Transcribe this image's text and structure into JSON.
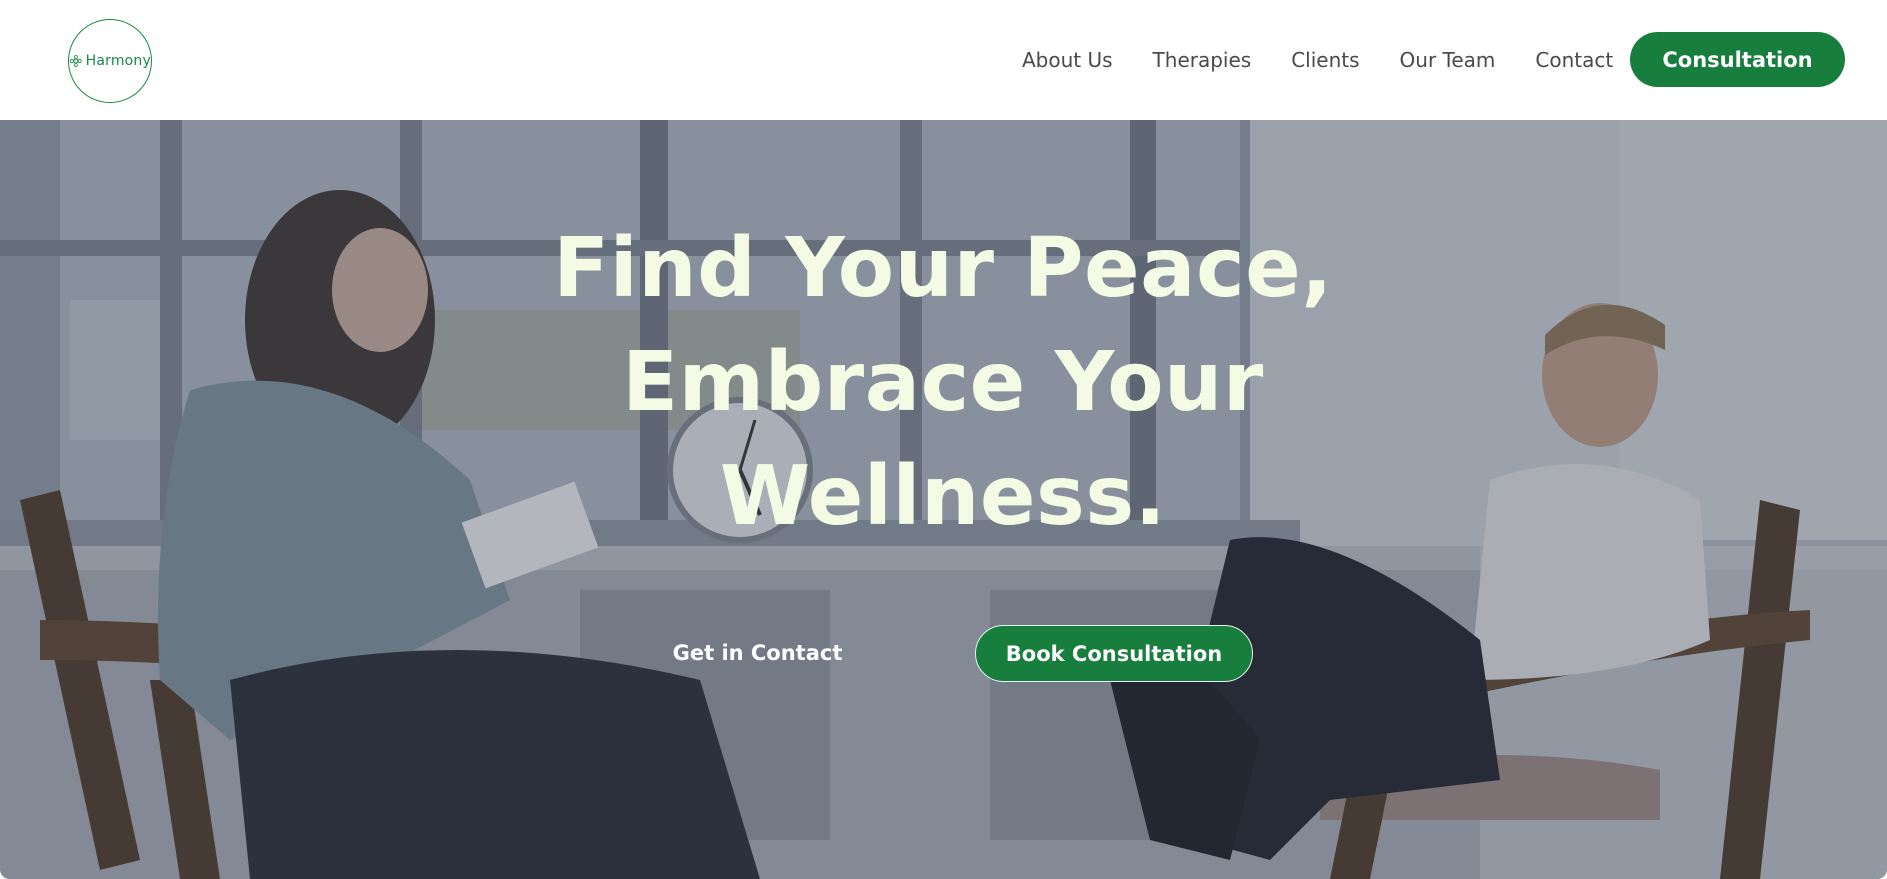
{
  "brand": {
    "name": "Harmony",
    "accent": "#177e3d",
    "headline_color": "#f3fbe4"
  },
  "nav": {
    "items": [
      {
        "label": "About Us"
      },
      {
        "label": "Therapies"
      },
      {
        "label": "Clients"
      },
      {
        "label": "Our Team"
      },
      {
        "label": "Contact"
      }
    ],
    "cta_label": "Consultation"
  },
  "hero": {
    "headline_lines": [
      "Find Your Peace,",
      "Embrace Your",
      "Wellness."
    ],
    "secondary_button": "Get in Contact",
    "primary_button": "Book Consultation",
    "image_icon": "therapy-session-photo"
  }
}
